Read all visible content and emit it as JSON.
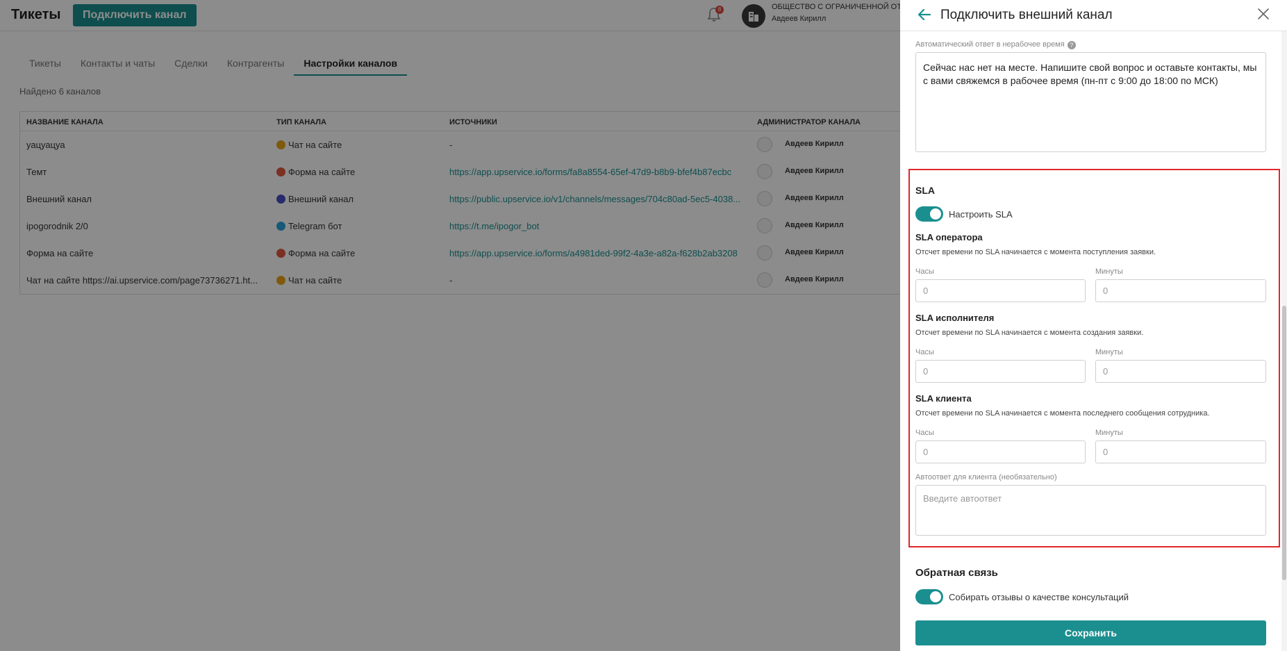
{
  "app": {
    "title": "Тикеты",
    "connect_button": "Подключить канал",
    "notifications_count": "8",
    "company_name": "ОБЩЕСТВО С ОГРАНИЧЕННОЙ ОТВ",
    "user_name": "Авдеев Кирилл"
  },
  "tabs": [
    "Тикеты",
    "Контакты и чаты",
    "Сделки",
    "Контрагенты",
    "Настройки каналов"
  ],
  "active_tab": "Настройки каналов",
  "found_text": "Найдено 6 каналов",
  "table": {
    "headers": [
      "НАЗВАНИЕ КАНАЛА",
      "ТИП КАНАЛА",
      "ИСТОЧНИКИ",
      "АДМИНИСТРАТОР КАНАЛА"
    ],
    "rows": [
      {
        "name": "уацуацуа",
        "type": "Чат на сайте",
        "type_color": "#e8a317",
        "source": "-",
        "admin": "Авдеев Кирилл"
      },
      {
        "name": "Темт",
        "type": "Форма на сайте",
        "type_color": "#e0583e",
        "source": "https://app.upservice.io/forms/fa8a8554-65ef-47d9-b8b9-bfef4b87ecbc",
        "admin": "Авдеев Кирилл"
      },
      {
        "name": "Внешний канал",
        "type": "Внешний канал",
        "type_color": "#4a4fc4",
        "source": "https://public.upservice.io/v1/channels/messages/704c80ad-5ec5-4038...",
        "admin": "Авдеев Кирилл"
      },
      {
        "name": "ipogorodnik 2/0",
        "type": "Telegram бот",
        "type_color": "#2aa3dc",
        "source": "https://t.me/ipogor_bot",
        "admin": "Авдеев Кирилл"
      },
      {
        "name": "Форма на сайте",
        "type": "Форма на сайте",
        "type_color": "#e0583e",
        "source": "https://app.upservice.io/forms/a4981ded-99f2-4a3e-a82a-f628b2ab3208",
        "admin": "Авдеев Кирилл"
      },
      {
        "name": "Чат на сайте https://ai.upservice.com/page73736271.ht...",
        "type": "Чат на сайте",
        "type_color": "#e8a317",
        "source": "-",
        "admin": "Авдеев Кирилл"
      }
    ]
  },
  "drawer": {
    "title": "Подключить внешний канал",
    "offhours_label": "Автоматический ответ в нерабочее время",
    "offhours_text": "Сейчас нас нет на месте. Напишите свой вопрос и оставьте контакты, мы с вами свяжемся в рабочее время (пн-пт с 9:00 до 18:00 по МСК)",
    "sla": {
      "title": "SLA",
      "toggle_label": "Настроить SLA",
      "hours_label": "Часы",
      "minutes_label": "Минуты",
      "blocks": [
        {
          "title": "SLA оператора",
          "desc": "Отсчет времени по SLA начинается с момента поступления заявки.",
          "hours": "0",
          "minutes": "0"
        },
        {
          "title": "SLA исполнителя",
          "desc": "Отсчет времени по SLA начинается с момента создания заявки.",
          "hours": "0",
          "minutes": "0"
        },
        {
          "title": "SLA клиента",
          "desc": "Отсчет времени по SLA начинается с момента последнего сообщения сотрудника.",
          "hours": "0",
          "minutes": "0"
        }
      ],
      "autoreply_label": "Автоответ для клиента (необязательно)",
      "autoreply_placeholder": "Введите автоответ"
    },
    "feedback": {
      "title": "Обратная связь",
      "toggle_label": "Собирать отзывы о качестве консультаций"
    },
    "save_button": "Сохранить"
  },
  "colors": {
    "accent": "#1b8f8f",
    "highlight_frame": "#e0262c"
  }
}
